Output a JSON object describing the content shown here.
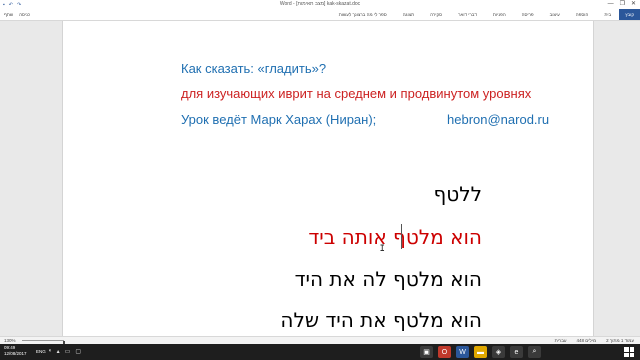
{
  "window": {
    "title": "Word - [מצב תאימות] kak-skazat.doc",
    "controls": [
      "—",
      "❐",
      "✕"
    ]
  },
  "ribbon": {
    "file_tab": "קובץ",
    "tabs": [
      "בית",
      "הוספה",
      "עיצוב",
      "פריסה",
      "הפניות",
      "דברי דואר",
      "סקירה",
      "תצוגה"
    ],
    "extra": [
      "שתף",
      "כניסה"
    ],
    "tell_me": "ספר לי מה ברצונך לעשות"
  },
  "document": {
    "ru_line1": "Как сказать: «гладить»?",
    "ru_line2": "для изучающих иврит на среднем и продвинутом уровнях",
    "ru_line3": "Урок ведёт Марк Харах (Ниран);",
    "email": "hebron@narod.ru",
    "he_line1": "ללטף",
    "he_line2": "הוא מלטף אותה ביד",
    "he_line3": "הוא מלטף לה את היד",
    "he_line4": "הוא מלטף את היד שלה",
    "accent_blue": "#1f6fb1",
    "accent_red": "#cc2222"
  },
  "statusbar": {
    "zoom": "130%",
    "items": [
      "עמוד 1 מתוך 2",
      "448 מילים",
      "עברית"
    ]
  },
  "taskbar": {
    "time": "09:49",
    "date": "12/08/2017",
    "lang": "ENG"
  }
}
